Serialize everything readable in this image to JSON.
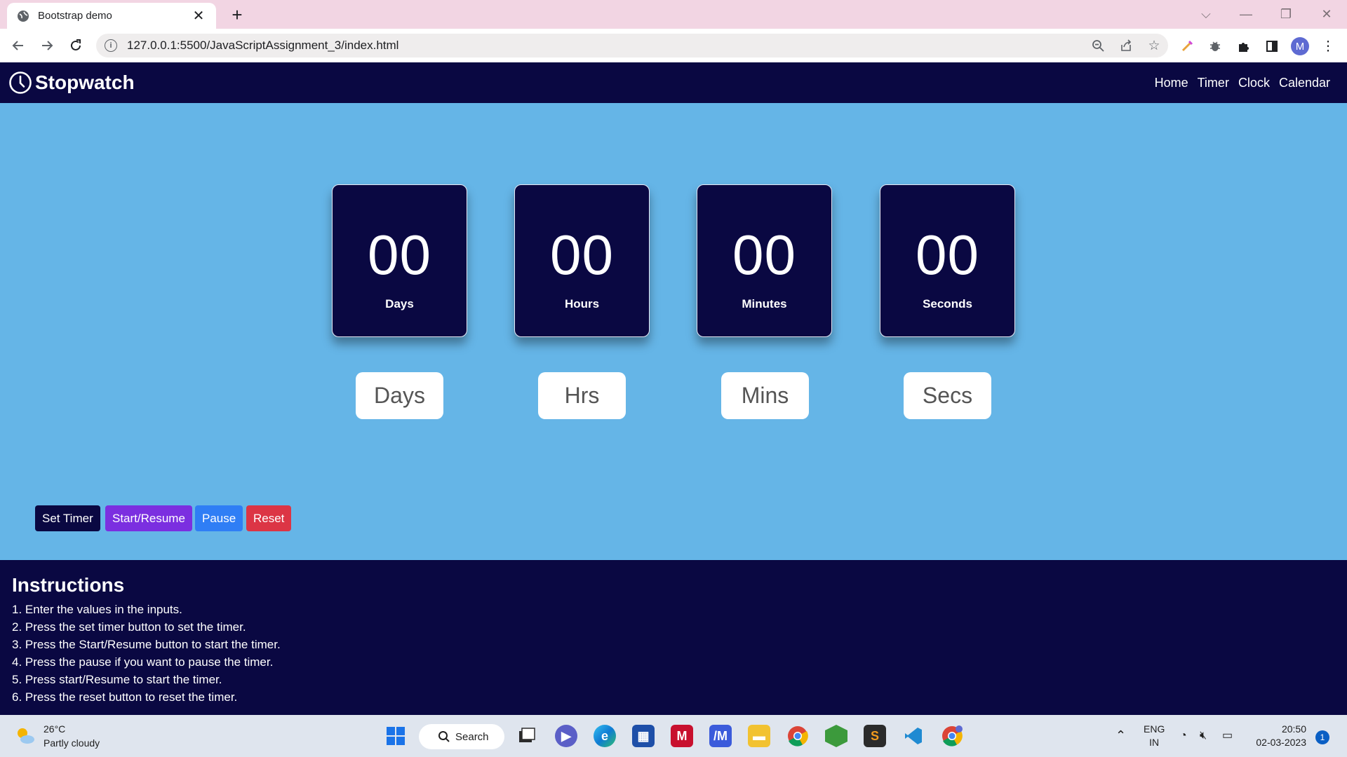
{
  "browser": {
    "tab_title": "Bootstrap demo",
    "url": "127.0.0.1:5500/JavaScriptAssignment_3/index.html",
    "profile_initial": "M"
  },
  "navbar": {
    "brand": "Stopwatch",
    "links": [
      "Home",
      "Timer",
      "Clock",
      "Calendar"
    ]
  },
  "cards": [
    {
      "value": "00",
      "label": "Days"
    },
    {
      "value": "00",
      "label": "Hours"
    },
    {
      "value": "00",
      "label": "Minutes"
    },
    {
      "value": "00",
      "label": "Seconds"
    }
  ],
  "inputs": {
    "days_placeholder": "Days",
    "hours_placeholder": "Hrs",
    "minutes_placeholder": "Mins",
    "seconds_placeholder": "Secs"
  },
  "buttons": {
    "set_timer": "Set Timer",
    "start_resume": "Start/Resume",
    "pause": "Pause",
    "reset": "Reset"
  },
  "colors": {
    "navy": "#0a0842",
    "sky": "#65b5e7",
    "purple": "#7b2fe0",
    "blue": "#2f7ef5",
    "red": "#dc3545"
  },
  "instructions": {
    "title": "Instructions",
    "steps": [
      "1. Enter the values in the inputs.",
      "2. Press the set timer button to set the timer.",
      "3. Press the Start/Resume button to start the timer.",
      "4. Press the pause if you want to pause the timer.",
      "5. Press start/Resume to start the timer.",
      "6. Press the reset button to reset the timer."
    ]
  },
  "taskbar": {
    "temperature": "26°C",
    "weather": "Partly cloudy",
    "search_label": "Search",
    "lang_top": "ENG",
    "lang_bottom": "IN",
    "time": "20:50",
    "date": "02-03-2023",
    "notification_count": "1"
  }
}
